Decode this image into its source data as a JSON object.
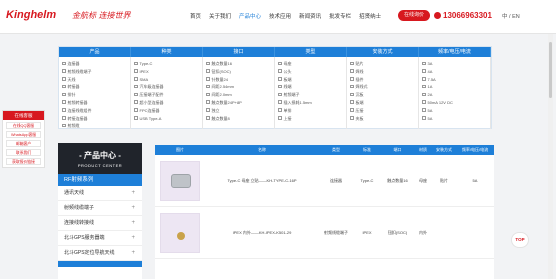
{
  "header": {
    "logo": "Kinghelm",
    "slogan": "金航标 连接世界",
    "nav": [
      "首页",
      "关于我们",
      "产品中心",
      "技术应用",
      "新闻资讯",
      "批发专栏",
      "招贤纳士"
    ],
    "nav_active_index": 2,
    "cta_label": "在线询价",
    "phone": "13066963301",
    "lang": "中 / EN"
  },
  "filter": {
    "headers": [
      "产品",
      "种类",
      "接口",
      "类型",
      "安装方式",
      "频率/电压/电流"
    ],
    "columns": [
      [
        "连接器",
        "射频线缆端子",
        "天线",
        "转接器",
        "排针",
        "射频转接器",
        "连接线缆组件",
        "转接连接器",
        "射频缆"
      ],
      [
        "Type-C",
        "IPEX",
        "SMA",
        "汽车级连接器",
        "压接端子配件",
        "超小型连接器",
        "FPC连接器",
        "USB Type-A"
      ],
      [
        "触点数量16",
        "钮扣(SOC)",
        "针数量24",
        "间距2.54mm",
        "间距2.0mm",
        "触点数量24P+8P",
        "独立",
        "触点数量8"
      ],
      [
        "母座",
        "公头",
        "板端",
        "线端",
        "射频端子",
        "插入损耗1.5mm",
        "单排",
        "上接"
      ],
      [
        "贴片",
        "焊线",
        "插件",
        "焊线式",
        "沉板",
        "板端",
        "压接",
        "夹板"
      ],
      [
        "3A",
        "4A",
        "7.5A",
        "1A",
        "2A",
        "50mA 12V DC",
        "5A",
        "5A"
      ]
    ]
  },
  "service": {
    "title": "在线客服",
    "items": [
      "在线QQ客服",
      "WhatsApp客服",
      "邮箱客户",
      "联系我们",
      "获取报价链接"
    ]
  },
  "sidebar": {
    "title": "- 产品中心 -",
    "subtitle": "PRODUCT CENTER",
    "category": "RF射频系列",
    "items": [
      "通讯天线",
      "射频线缆端子",
      "连接线转接线",
      "北斗GPS服务器端",
      "北斗GPS定位导航天线"
    ]
  },
  "table": {
    "headers": [
      "图片",
      "名称",
      "类型",
      "标准",
      "端口",
      "材质",
      "安装方式",
      "频率/电压/电流"
    ],
    "rows": [
      {
        "name": "Type-C 母座 立贴——KH-TYPE-C-16P",
        "type": "连接器",
        "std": "Type-C",
        "term": "触点数量16",
        "mat": "母座",
        "mount": "贴片",
        "freq": "5A"
      },
      {
        "name": "IPEX 内外——KH-IPEX-K501-29",
        "type": "射频线缆端子",
        "std": "IPEX",
        "term": "钮扣(SOC)",
        "mat": "内外",
        "mount": "",
        "freq": ""
      }
    ]
  },
  "top_button": "TOP"
}
